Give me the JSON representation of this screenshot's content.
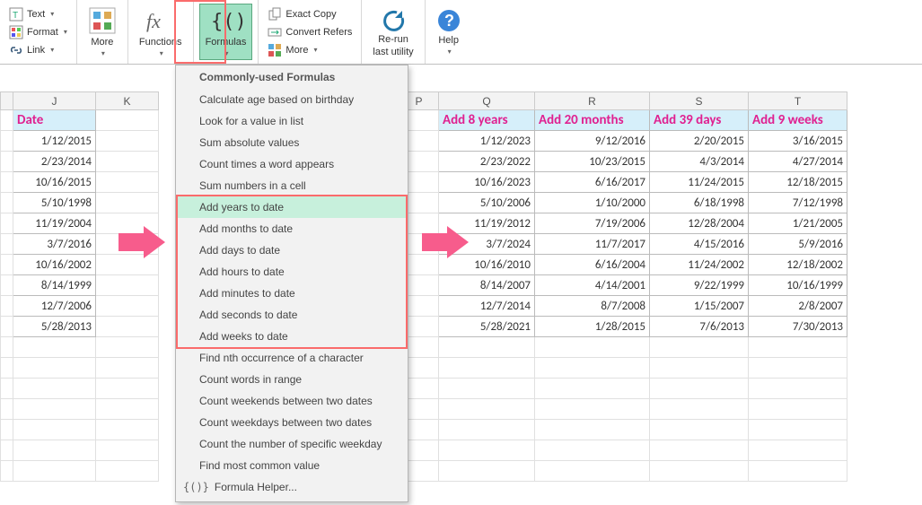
{
  "ribbon": {
    "text_label": "Text",
    "format_label": "Format",
    "link_label": "Link",
    "more1_label": "More",
    "functions_label": "Functions",
    "formulas_label": "Formulas",
    "exact_copy_label": "Exact Copy",
    "convert_refers_label": "Convert Refers",
    "more2_label": "More",
    "rerun_label": "Re-run",
    "rerun_label2": "last utility",
    "help_label": "Help"
  },
  "dropdown": {
    "title": "Commonly-used Formulas",
    "items": [
      "Calculate age based on birthday",
      "Look for a value in list",
      "Sum absolute values",
      "Count times a word appears",
      "Sum numbers in a cell",
      "Add years to date",
      "Add months to date",
      "Add days to date",
      "Add hours to date",
      "Add minutes to date",
      "Add seconds to date",
      "Add weeks to date",
      "Find nth occurrence of a character",
      "Count words in range",
      "Count weekends between two dates",
      "Count weekdays between two dates",
      "Count the number of specific weekday",
      "Find most common value"
    ],
    "helper": "Formula Helper..."
  },
  "columns": [
    "J",
    "K",
    "",
    "P",
    "Q",
    "R",
    "S",
    "T"
  ],
  "headers": {
    "J": "Date",
    "Q": "Add 8 years",
    "R": "Add 20 months",
    "S": "Add 39 days",
    "T": "Add 9 weeks"
  },
  "dates": [
    "1/12/2015",
    "2/23/2014",
    "10/16/2015",
    "5/10/1998",
    "11/19/2004",
    "3/7/2016",
    "10/16/2002",
    "8/14/1999",
    "12/7/2006",
    "5/28/2013"
  ],
  "results": {
    "Q": [
      "1/12/2023",
      "2/23/2022",
      "10/16/2023",
      "5/10/2006",
      "11/19/2012",
      "3/7/2024",
      "10/16/2010",
      "8/14/2007",
      "12/7/2014",
      "5/28/2021"
    ],
    "R": [
      "9/12/2016",
      "10/23/2015",
      "6/16/2017",
      "1/10/2000",
      "7/19/2006",
      "11/7/2017",
      "6/16/2004",
      "4/14/2001",
      "8/7/2008",
      "1/28/2015"
    ],
    "S": [
      "2/20/2015",
      "4/3/2014",
      "11/24/2015",
      "6/18/1998",
      "12/28/2004",
      "4/15/2016",
      "11/24/2002",
      "9/22/1999",
      "1/15/2007",
      "7/6/2013"
    ],
    "T": [
      "3/16/2015",
      "4/27/2014",
      "12/18/2015",
      "7/12/1998",
      "1/21/2005",
      "5/9/2016",
      "12/18/2002",
      "10/16/1999",
      "2/8/2007",
      "7/30/2013"
    ]
  }
}
